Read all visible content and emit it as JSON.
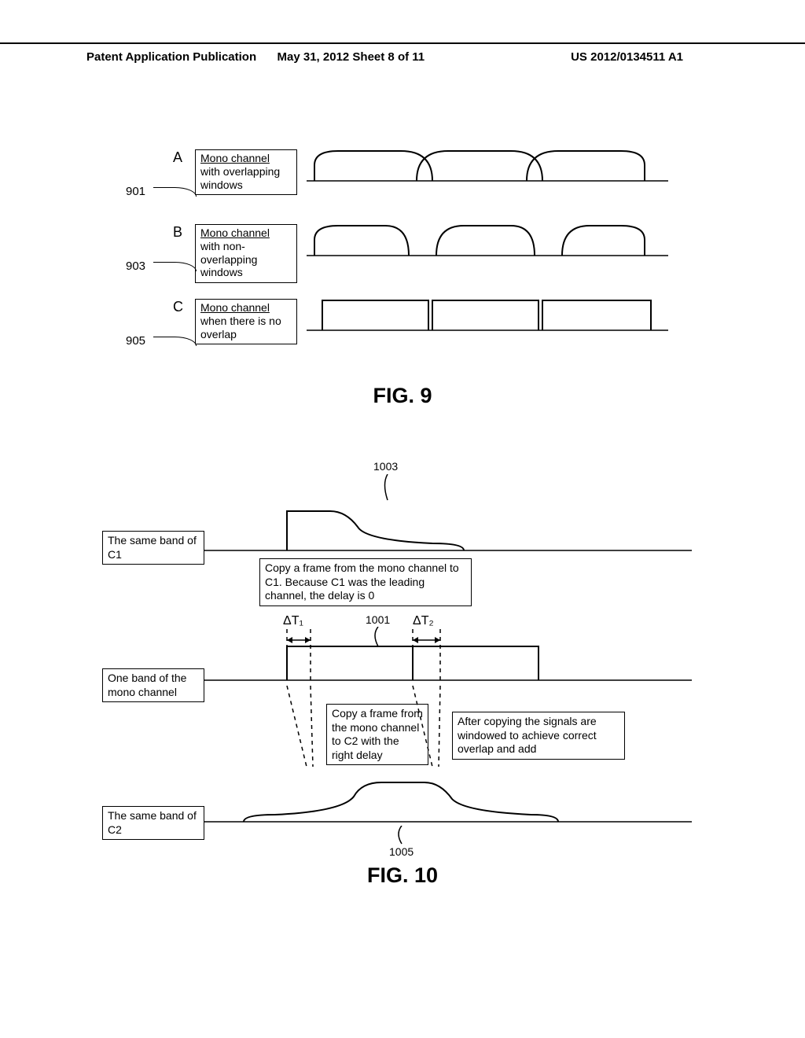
{
  "header": {
    "left": "Patent Application Publication",
    "center": "May 31, 2012  Sheet 8 of 11",
    "right": "US 2012/0134511 A1"
  },
  "fig9": {
    "title": "FIG. 9",
    "rows": [
      {
        "letter": "A",
        "num": "901",
        "label_u": "Mono channel",
        "label_rest": "with overlapping windows"
      },
      {
        "letter": "B",
        "num": "903",
        "label_u": "Mono channel",
        "label_rest": "with non-overlapping windows"
      },
      {
        "letter": "C",
        "num": "905",
        "label_u": "Mono channel",
        "label_rest": "when there is no overlap"
      }
    ]
  },
  "fig10": {
    "title": "FIG. 10",
    "label_c1": "The same band of C1",
    "label_mono": "One band of the mono channel",
    "label_c2": "The same band of C2",
    "note_c1": "Copy a frame from the mono channel to C1. Because C1 was the leading channel, the delay is 0",
    "note_c2": "Copy a frame from the mono channel to C2 with the right delay",
    "note_post": "After copying the signals are windowed to achieve correct overlap and add",
    "dt1": "ΔT₁",
    "dt2": "ΔT₂",
    "ref_1001": "1001",
    "ref_1003": "1003",
    "ref_1005": "1005"
  }
}
